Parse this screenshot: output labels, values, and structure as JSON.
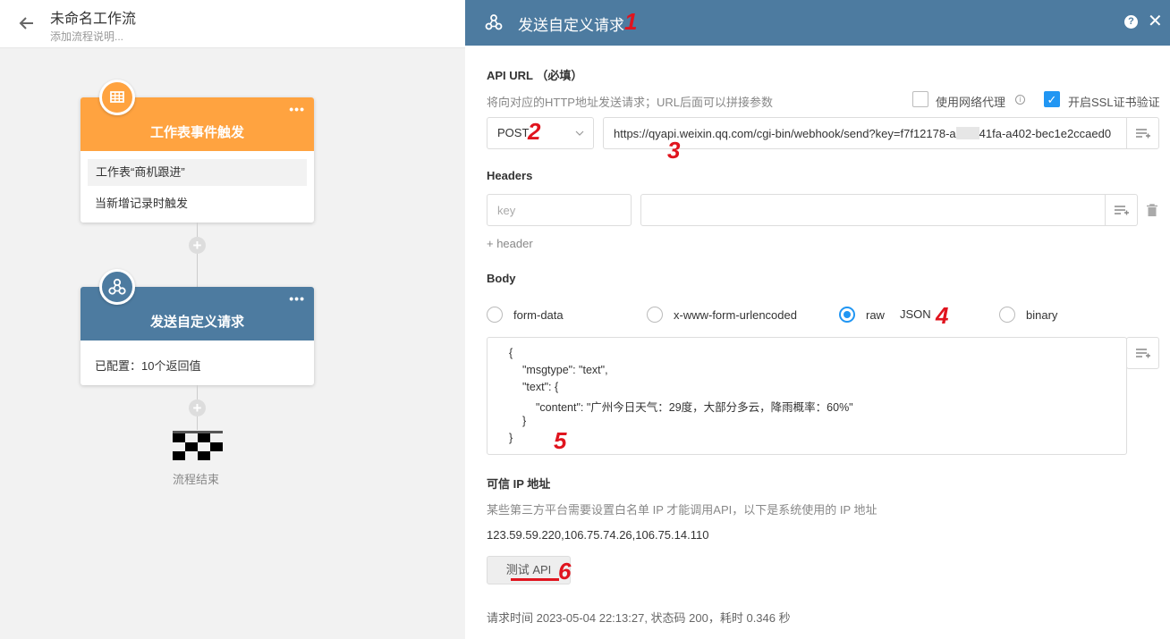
{
  "workflow": {
    "title": "未命名工作流",
    "description_placeholder": "添加流程说明..."
  },
  "nodes": {
    "trigger": {
      "title": "工作表事件触发",
      "worksheet": "工作表“商机跟进”",
      "condition": "当新增记录时触发",
      "color": "#ffa340"
    },
    "request": {
      "title": "发送自定义请求",
      "summary": "已配置：10个返回值",
      "color": "#4d7ba0"
    },
    "end": {
      "label": "流程结束"
    }
  },
  "panel": {
    "title": "发送自定义请求",
    "header_color": "#4d7ba0",
    "api_url": {
      "label": "API URL （必填）",
      "hint": "将向对应的HTTP地址发送请求；URL后面可以拼接参数",
      "use_proxy_label": "使用网络代理",
      "use_proxy": false,
      "ssl_label": "开启SSL证书验证",
      "ssl": true,
      "method": "POST",
      "url_part1": "https://qyapi.weixin.qq.com/cgi-bin/webhook/send?key=f7f12178-a",
      "url_part2": "41fa-a402-bec1e2ccaed0"
    },
    "headers": {
      "label": "Headers",
      "key_placeholder": "key",
      "value_placeholder": "",
      "add_label": "+ header"
    },
    "body": {
      "label": "Body",
      "options": [
        "form-data",
        "x-www-form-urlencoded",
        "raw",
        "binary"
      ],
      "selected": "raw",
      "raw_format": "JSON",
      "code_lines": [
        "{",
        "\"msgtype\": \"text\",",
        "\"text\": {",
        "\"content\": \"广州今日天气：29度，大部分多云，降雨概率：60%\"",
        "}",
        "}"
      ]
    },
    "trusted_ip": {
      "label": "可信 IP 地址",
      "hint": "某些第三方平台需要设置白名单 IP 才能调用API，以下是系统使用的 IP 地址",
      "value": "123.59.59.220,106.75.74.26,106.75.14.110"
    },
    "test": {
      "button_label": "测试 API",
      "result": "请求时间 2023-05-04 22:13:27, 状态码 200，耗时 0.346 秒"
    },
    "accent_color": "#2196f3"
  },
  "annotations": [
    "1",
    "2",
    "3",
    "4",
    "5",
    "6"
  ],
  "annotation_color": "#e0141e"
}
